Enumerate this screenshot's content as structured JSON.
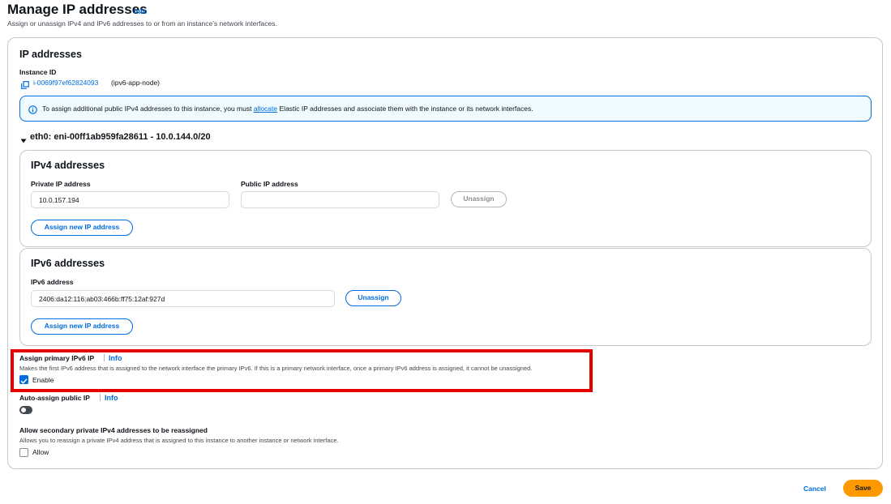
{
  "header": {
    "title": "Manage IP addresses",
    "info": "Info",
    "description": "Assign or unassign IPv4 and IPv6 addresses to or from an instance's network interfaces."
  },
  "ip_section": {
    "title": "IP addresses",
    "instance_label": "Instance ID",
    "instance_id": "i-0069f97ef62824093",
    "instance_name": "(ipv6-app-node)",
    "alert_prefix": "To assign additional public IPv4 addresses to this instance, you must",
    "alert_link": "allocate",
    "alert_suffix": "Elastic IP addresses and associate them with the instance or its network interfaces.",
    "interface_label": "eth0: eni-00ff1ab959fa28611 - 10.0.144.0/20"
  },
  "ipv4": {
    "title": "IPv4 addresses",
    "private_label": "Private IP address",
    "private_value": "10.0.157.194",
    "public_label": "Public IP address",
    "public_value": "",
    "unassign": "Unassign",
    "assign_new": "Assign new IP address"
  },
  "ipv6": {
    "title": "IPv6 addresses",
    "address_label": "IPv6 address",
    "address_value": "2406:da12:116:ab03:466b:ff75:12af:927d",
    "unassign": "Unassign",
    "assign_new": "Assign new IP address"
  },
  "primary_ipv6": {
    "label": "Assign primary IPv6 IP",
    "info": "Info",
    "description": "Makes the first IPv6 address that is assigned to the network interface the primary IPv6. If this is a primary network interface, once a primary IPv6 address is assigned, it cannot be unassigned.",
    "checkbox_label": "Enable",
    "checked": true
  },
  "auto_assign": {
    "label": "Auto-assign public IP",
    "info": "Info",
    "enabled": false
  },
  "secondary": {
    "label": "Allow secondary private IPv4 addresses to be reassigned",
    "description": "Allows you to reassign a private IPv4 address that is assigned to this instance to another instance or network interface.",
    "checkbox_label": "Allow",
    "checked": false
  },
  "footer": {
    "cancel": "Cancel",
    "save": "Save"
  },
  "colors": {
    "accent": "#006ce0",
    "primary_button": "#ff9900",
    "highlight": "#e50000"
  }
}
